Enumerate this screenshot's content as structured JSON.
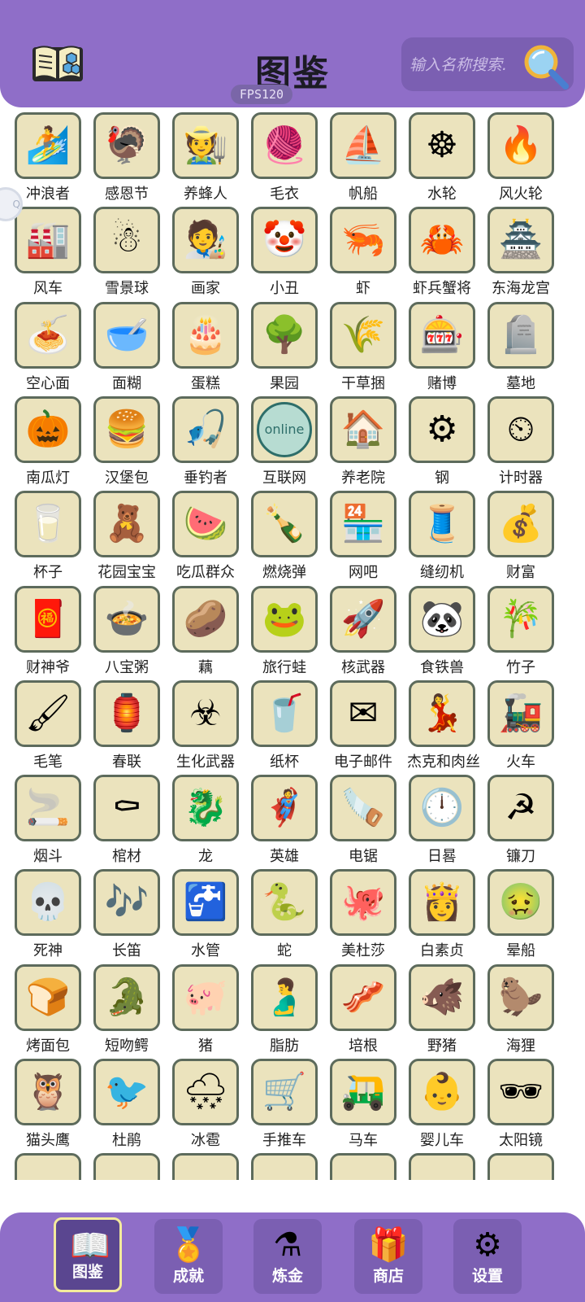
{
  "header": {
    "title": "图鉴",
    "fps": "FPS120",
    "search_placeholder": "输入名称搜索."
  },
  "side_bubble": "Q",
  "items": [
    [
      {
        "label": "冲浪者",
        "icon": "🏄"
      },
      {
        "label": "感恩节",
        "icon": "🦃"
      },
      {
        "label": "养蜂人",
        "icon": "🧑‍🌾"
      },
      {
        "label": "毛衣",
        "icon": "🧶"
      },
      {
        "label": "帆船",
        "icon": "⛵"
      },
      {
        "label": "水轮",
        "icon": "☸"
      },
      {
        "label": "风火轮",
        "icon": "🔥"
      }
    ],
    [
      {
        "label": "风车",
        "icon": "🏭"
      },
      {
        "label": "雪景球",
        "icon": "☃"
      },
      {
        "label": "画家",
        "icon": "🧑‍🎨"
      },
      {
        "label": "小丑",
        "icon": "🤡"
      },
      {
        "label": "虾",
        "icon": "🦐"
      },
      {
        "label": "虾兵蟹将",
        "icon": "🦀"
      },
      {
        "label": "东海龙宫",
        "icon": "🏯"
      }
    ],
    [
      {
        "label": "空心面",
        "icon": "🍝"
      },
      {
        "label": "面糊",
        "icon": "🥣"
      },
      {
        "label": "蛋糕",
        "icon": "🎂"
      },
      {
        "label": "果园",
        "icon": "🌳"
      },
      {
        "label": "干草捆",
        "icon": "🌾"
      },
      {
        "label": "赌博",
        "icon": "🎰"
      },
      {
        "label": "墓地",
        "icon": "🪦"
      }
    ],
    [
      {
        "label": "南瓜灯",
        "icon": "🎃"
      },
      {
        "label": "汉堡包",
        "icon": "🍔"
      },
      {
        "label": "垂钓者",
        "icon": "🎣"
      },
      {
        "label": "互联网",
        "icon": "online",
        "text_icon": true
      },
      {
        "label": "养老院",
        "icon": "🏠"
      },
      {
        "label": "钢",
        "icon": "⚙"
      },
      {
        "label": "计时器",
        "icon": "⏲"
      }
    ],
    [
      {
        "label": "杯子",
        "icon": "🥛"
      },
      {
        "label": "花园宝宝",
        "icon": "🧸"
      },
      {
        "label": "吃瓜群众",
        "icon": "🍉"
      },
      {
        "label": "燃烧弹",
        "icon": "🍾"
      },
      {
        "label": "网吧",
        "icon": "🏪"
      },
      {
        "label": "缝纫机",
        "icon": "🧵"
      },
      {
        "label": "财富",
        "icon": "💰"
      }
    ],
    [
      {
        "label": "财神爷",
        "icon": "🧧"
      },
      {
        "label": "八宝粥",
        "icon": "🍲"
      },
      {
        "label": "藕",
        "icon": "🥔"
      },
      {
        "label": "旅行蛙",
        "icon": "🐸"
      },
      {
        "label": "核武器",
        "icon": "🚀"
      },
      {
        "label": "食铁兽",
        "icon": "🐼"
      },
      {
        "label": "竹子",
        "icon": "🎋"
      }
    ],
    [
      {
        "label": "毛笔",
        "icon": "🖌"
      },
      {
        "label": "春联",
        "icon": "🏮"
      },
      {
        "label": "生化武器",
        "icon": "☣"
      },
      {
        "label": "纸杯",
        "icon": "🥤"
      },
      {
        "label": "电子邮件",
        "icon": "✉"
      },
      {
        "label": "杰克和肉丝",
        "icon": "💃"
      },
      {
        "label": "火车",
        "icon": "🚂"
      }
    ],
    [
      {
        "label": "烟斗",
        "icon": "🚬"
      },
      {
        "label": "棺材",
        "icon": "⚰"
      },
      {
        "label": "龙",
        "icon": "🐉"
      },
      {
        "label": "英雄",
        "icon": "🦸"
      },
      {
        "label": "电锯",
        "icon": "🪚"
      },
      {
        "label": "日晷",
        "icon": "🕛"
      },
      {
        "label": "镰刀",
        "icon": "☭"
      }
    ],
    [
      {
        "label": "死神",
        "icon": "💀"
      },
      {
        "label": "长笛",
        "icon": "🎶"
      },
      {
        "label": "水管",
        "icon": "🚰"
      },
      {
        "label": "蛇",
        "icon": "🐍"
      },
      {
        "label": "美杜莎",
        "icon": "🐙"
      },
      {
        "label": "白素贞",
        "icon": "👸"
      },
      {
        "label": "晕船",
        "icon": "🤢"
      }
    ],
    [
      {
        "label": "烤面包",
        "icon": "🍞"
      },
      {
        "label": "短吻鳄",
        "icon": "🐊"
      },
      {
        "label": "猪",
        "icon": "🐖"
      },
      {
        "label": "脂肪",
        "icon": "🫃"
      },
      {
        "label": "培根",
        "icon": "🥓"
      },
      {
        "label": "野猪",
        "icon": "🐗"
      },
      {
        "label": "海狸",
        "icon": "🦫"
      }
    ],
    [
      {
        "label": "猫头鹰",
        "icon": "🦉"
      },
      {
        "label": "杜鹃",
        "icon": "🐦"
      },
      {
        "label": "冰雹",
        "icon": "🌨"
      },
      {
        "label": "手推车",
        "icon": "🛒"
      },
      {
        "label": "马车",
        "icon": "🛺"
      },
      {
        "label": "婴儿车",
        "icon": "👶"
      },
      {
        "label": "太阳镜",
        "icon": "🕶"
      }
    ]
  ],
  "nav": [
    {
      "label": "图鉴",
      "icon": "📖",
      "active": true
    },
    {
      "label": "成就",
      "icon": "🏅",
      "active": false
    },
    {
      "label": "炼金",
      "icon": "⚗",
      "active": false
    },
    {
      "label": "商店",
      "icon": "🎁",
      "active": false
    },
    {
      "label": "设置",
      "icon": "⚙",
      "active": false
    }
  ]
}
